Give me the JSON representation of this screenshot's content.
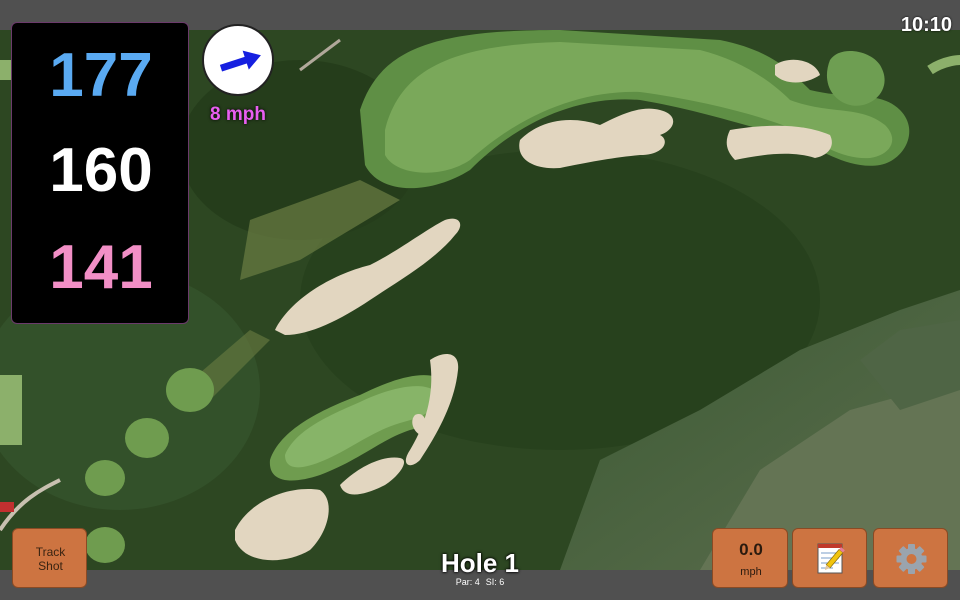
{
  "status": {
    "time": "10:10"
  },
  "yardages": {
    "back": "177",
    "center": "160",
    "front": "141"
  },
  "wind": {
    "speed": "8 mph",
    "icon": "wind-direction-arrow-icon"
  },
  "hole": {
    "title": "Hole 1",
    "par": "Par: 4",
    "stroke_index": "SI: 6"
  },
  "buttons": {
    "track_shot_line1": "Track",
    "track_shot_line2": "Shot",
    "speed_value": "0.0",
    "speed_unit": "mph",
    "notes_icon": "notepad-pencil-icon",
    "settings_icon": "gear-icon"
  },
  "colors": {
    "back_yardage": "#5aaaf2",
    "center_yardage": "#ffffff",
    "front_yardage": "#f28fc6",
    "wind_text": "#e85ef0",
    "button": "#cd7441"
  }
}
